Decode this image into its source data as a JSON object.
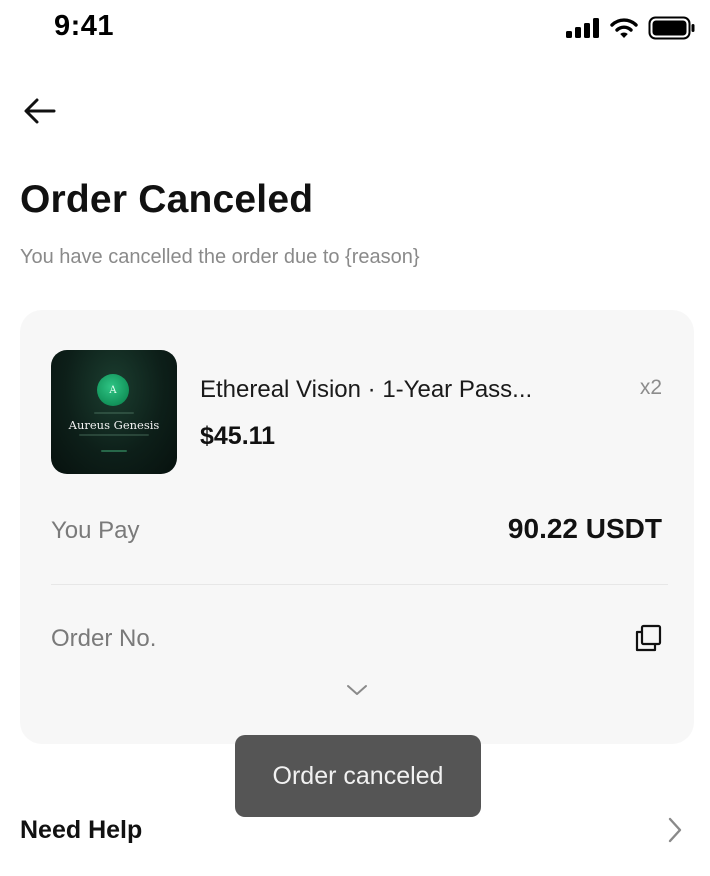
{
  "status_bar": {
    "time": "9:41",
    "icons": [
      "cellular-signal-icon",
      "wifi-icon",
      "battery-icon"
    ]
  },
  "header": {
    "back_icon": "arrow-left-icon",
    "title": "Order Canceled",
    "subtitle": "You have cancelled the order due to {reason}"
  },
  "order": {
    "product": {
      "thumbnail_text": "Aureus Genesis",
      "thumbnail_logo_letter": "A",
      "name": "Ethereal Vision · 1-Year Pass...",
      "quantity": "x2",
      "price": "$45.11"
    },
    "you_pay_label": "You Pay",
    "you_pay_value": "90.22 USDT",
    "order_no_label": "Order No.",
    "order_no_value": "",
    "copy_icon": "copy-icon",
    "expand_icon": "chevron-down-icon"
  },
  "toast": {
    "message": "Order canceled"
  },
  "help": {
    "label": "Need Help",
    "icon": "chevron-right-icon"
  },
  "colors": {
    "card_background": "#f7f7f7",
    "toast_background": "#555555",
    "muted_text": "#8a8a8a",
    "thumbnail_accent": "#12935a"
  }
}
